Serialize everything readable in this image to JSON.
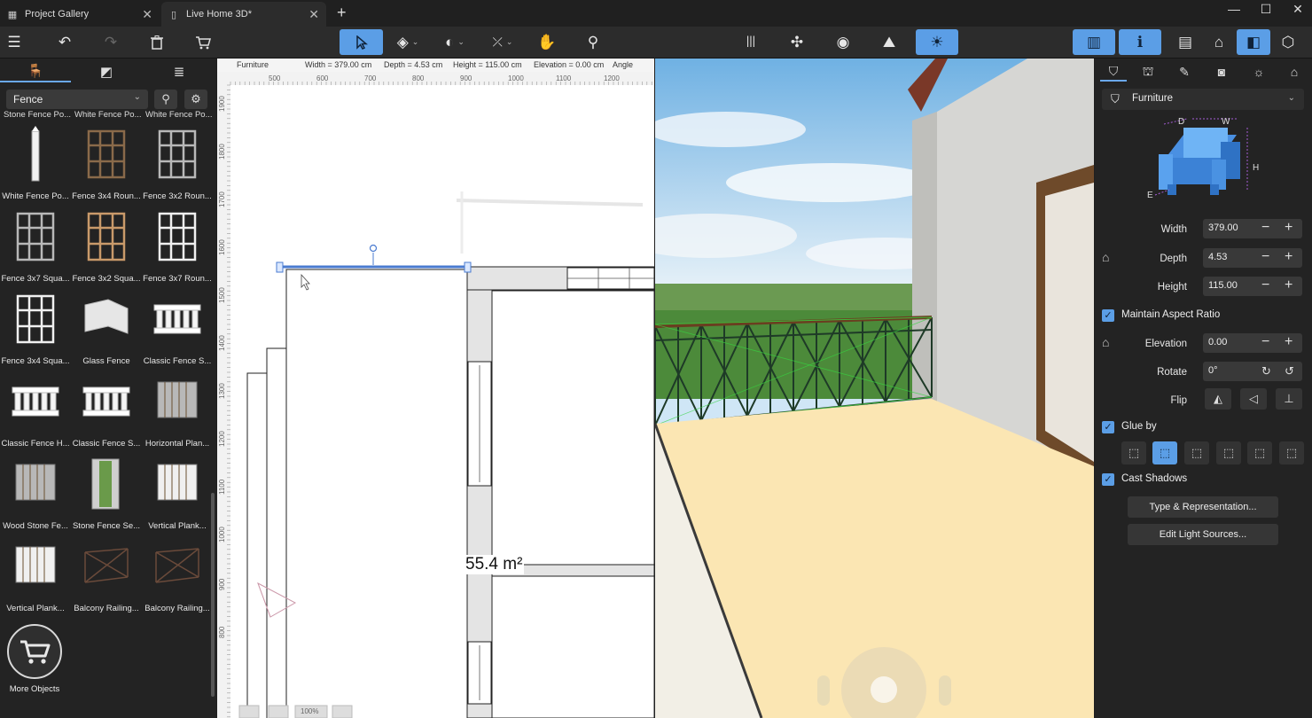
{
  "tabs": {
    "gallery": "Project Gallery",
    "document": "Live Home 3D*"
  },
  "library": {
    "category": "Fence",
    "top_row_labels": [
      "Stone Fence Po...",
      "White Fence Po...",
      "White Fence Po..."
    ],
    "items": [
      "White Fence Po...",
      "Fence 3x4 Roun...",
      "Fence 3x2 Roun...",
      "Fence 3x7 Squa...",
      "Fence 3x2 Squa...",
      "Fence 3x7 Roun...",
      "Fence 3x4 Squa...",
      "Glass Fence",
      "Classic Fence S...",
      "Classic Fence H...",
      "Classic Fence S...",
      "Horizontal Plan...",
      "Wood Stone Fe...",
      "Stone Fence Se...",
      "Vertical Plank...",
      "Vertical Plank...",
      "Balcony Railing...",
      "Balcony Railing..."
    ],
    "more_label": "More Objects"
  },
  "plan": {
    "info_type": "Furniture",
    "info_width": "Width = 379.00 cm",
    "info_depth": "Depth = 4.53 cm",
    "info_height": "Height = 115.00 cm",
    "info_elevation": "Elevation = 0.00 cm",
    "info_angle": "Angle",
    "ruler_top": [
      "500",
      "600",
      "700",
      "800",
      "900",
      "1000",
      "1100",
      "1200"
    ],
    "ruler_left": [
      "1900",
      "1800",
      "1700",
      "1600",
      "1500",
      "1400",
      "1300",
      "1200",
      "1100",
      "1000",
      "900",
      "800"
    ],
    "area_label": "55.4 m²",
    "zoom": "100%"
  },
  "inspector": {
    "category": "Furniture",
    "dim_labels": {
      "d": "D",
      "w": "W",
      "h": "H",
      "e": "E"
    },
    "width_label": "Width",
    "width_value": "379.00",
    "depth_label": "Depth",
    "depth_value": "4.53",
    "height_label": "Height",
    "height_value": "115.00",
    "maintain_aspect": "Maintain Aspect Ratio",
    "elevation_label": "Elevation",
    "elevation_value": "0.00",
    "rotate_label": "Rotate",
    "rotate_value": "0°",
    "flip_label": "Flip",
    "glue_label": "Glue by",
    "cast_shadows": "Cast Shadows",
    "type_button": "Type & Representation...",
    "light_button": "Edit Light Sources..."
  },
  "colors": {
    "accent": "#5b9ee6",
    "panel": "#232323",
    "toolbar": "#2c2c2c"
  }
}
